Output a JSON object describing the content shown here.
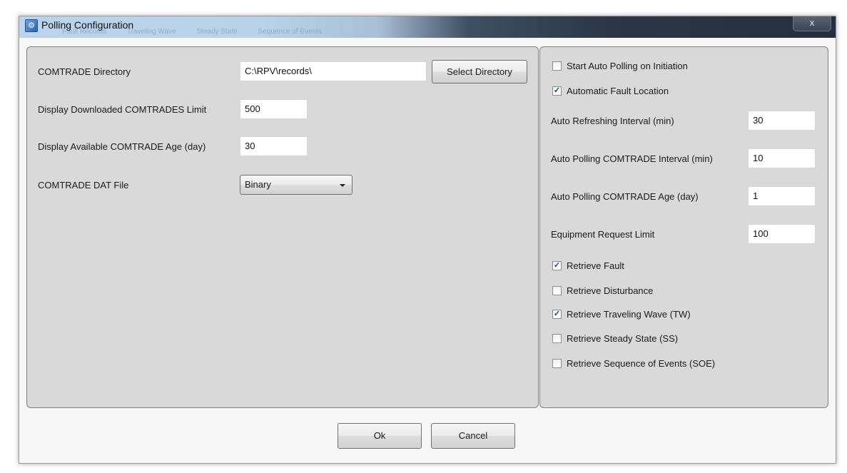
{
  "window": {
    "title": "Polling Configuration",
    "close_glyph": "x",
    "ghost_tabs": [
      "Fault Records",
      "Traveling Wave",
      "Steady State",
      "Sequence of Events"
    ]
  },
  "left": {
    "comtrade_dir": {
      "label": "COMTRADE Directory",
      "value": "C:\\RPV\\records\\",
      "button": "Select Directory"
    },
    "downloaded_limit": {
      "label": "Display Downloaded COMTRADES Limit",
      "value": "500"
    },
    "available_age": {
      "label": "Display Available COMTRADE Age (day)",
      "value": "30"
    },
    "dat_file": {
      "label": "COMTRADE DAT File",
      "selected": "Binary"
    }
  },
  "right": {
    "start_auto_polling": {
      "label": "Start Auto Polling on Initiation",
      "checked": false
    },
    "auto_fault_location": {
      "label": "Automatic Fault Location",
      "checked": true
    },
    "fields": [
      {
        "label": "Auto Refreshing Interval (min)",
        "value": "30"
      },
      {
        "label": "Auto Polling COMTRADE Interval (min)",
        "value": "10"
      },
      {
        "label": "Auto Polling COMTRADE Age (day)",
        "value": "1"
      },
      {
        "label": "Equipment Request Limit",
        "value": "100"
      }
    ],
    "retrieve": [
      {
        "label": "Retrieve Fault",
        "checked": true
      },
      {
        "label": "Retrieve Disturbance",
        "checked": false
      },
      {
        "label": "Retrieve Traveling Wave (TW)",
        "checked": true
      },
      {
        "label": "Retrieve Steady State (SS)",
        "checked": false
      },
      {
        "label": "Retrieve Sequence of Events (SOE)",
        "checked": false
      }
    ]
  },
  "footer": {
    "ok_label": "Ok",
    "cancel_label": "Cancel"
  },
  "check_glyph": "✓"
}
